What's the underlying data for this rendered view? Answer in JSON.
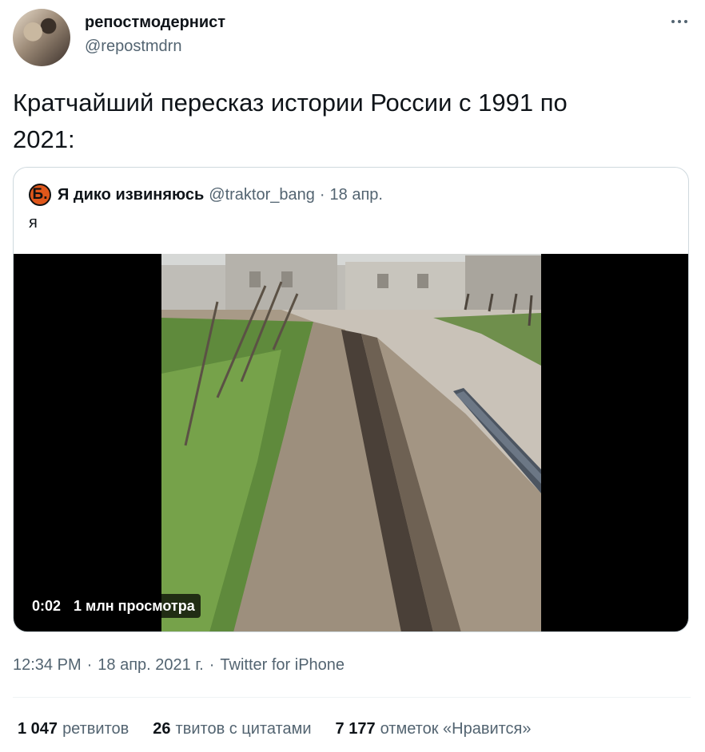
{
  "author": {
    "display_name": "репостмодернист",
    "handle": "@repostmdrn"
  },
  "tweet": {
    "text": "Кратчайший пересказ истории России с 1991 по\n2021:"
  },
  "quoted_tweet": {
    "avatar_letter": "Б.",
    "display_name": "Я дико извиняюсь",
    "handle": "@traktor_bang",
    "separator": "·",
    "date": "18 апр.",
    "text": "я",
    "video": {
      "duration": "0:02",
      "views": "1 млн просмотра"
    }
  },
  "meta": {
    "time": "12:34 PM",
    "separator": "·",
    "date": "18 апр. 2021 г.",
    "source": "Twitter for iPhone"
  },
  "stats": [
    {
      "count": "1 047",
      "label": "ретвитов"
    },
    {
      "count": "26",
      "label": "твитов с цитатами"
    },
    {
      "count": "7 177",
      "label": "отметок «Нравится»"
    }
  ],
  "colors": {
    "text_primary": "#0f1419",
    "text_secondary": "#536471",
    "border": "#cfd9de",
    "quoted_avatar": "#e0571b"
  },
  "icons": {
    "more": "more-horizontal-icon"
  }
}
